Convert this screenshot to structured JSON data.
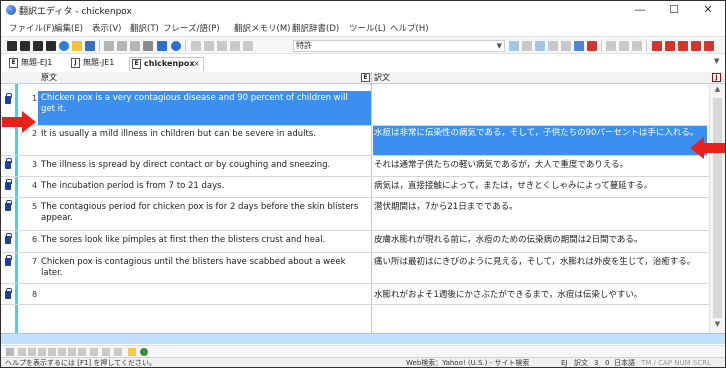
{
  "window": {
    "title": "翻訳エディタ - chickenpox",
    "minimize": "—",
    "maximize": "☐",
    "close": "✕"
  },
  "menu": [
    "ファイル(F)",
    "編集(E)",
    "表示(V)",
    "翻訳(T)",
    "フレーズ/語(P)",
    "翻訳メモリ(M)",
    "翻訳辞書(D)",
    "ツール(L)",
    "ヘルプ(H)"
  ],
  "toolbar": {
    "dictionary_select": "特許"
  },
  "tabs": [
    {
      "icon": "E",
      "label": "無題-EJ1"
    },
    {
      "icon": "J",
      "label": "無題-JE1"
    },
    {
      "icon": "E",
      "label": "chickenpox",
      "close": "×"
    }
  ],
  "grid": {
    "source_header": "原文",
    "target_header": "訳文",
    "rows": [
      {
        "num": "1",
        "source": "Chicken pox is a very contagious disease and 90 percent of children will get it.",
        "target": ""
      },
      {
        "num": "2",
        "source": "It is usually a mild illness in children but can be severe in adults.",
        "target": "水痘は非常に伝染性の病気である，そして，子供たちの90パーセントは手に入れる。"
      },
      {
        "num": "3",
        "source": "The illness is spread by direct contact or by coughing and sneezing.",
        "target": "それは通常子供たちの軽い病気であるが，大人で重度でありえる。"
      },
      {
        "num": "4",
        "source": "The incubation period is from 7 to 21 days.",
        "target": "病気は，直接接触によって，または，せきとくしゃみによって蔓延する。"
      },
      {
        "num": "5",
        "source": "The contagious period for chicken pox is for 2 days before the skin blisters appear.",
        "target": "潜伏期間は，7から21日までである。"
      },
      {
        "num": "6",
        "source": "The sores look like pimples at first then the blisters crust and heal.",
        "target": "皮膚水膨れが現れる前に，水痘のための伝染病の期間は2日間である。"
      },
      {
        "num": "7",
        "source": "Chicken pox is contagious until the blisters have scabbed about a week later.",
        "target": "痛い所は最初はにきびのように見える，そして，水膨れは外皮を生じて，治癒する。"
      },
      {
        "num": "8",
        "source": "",
        "target": "水膨れがおよそ1週後にかさぶたができるまで，水痘は伝染しやすい。"
      }
    ]
  },
  "status": {
    "help": "ヘルプを表示するには [F1] を押してください。",
    "web_search": "Web検索：Yahoo! (U.S.) - サイト検索",
    "mode": "EJ",
    "field": "訳文",
    "line": "3",
    "col": "0",
    "language": "日本語",
    "indicators": "TM / CAP NUM SCRL"
  },
  "colors": {
    "selection": "#3b8ff0",
    "lock_column": "#3fd6e0",
    "arrow": "#e8211b",
    "hscroll": "#bfe1ff"
  }
}
